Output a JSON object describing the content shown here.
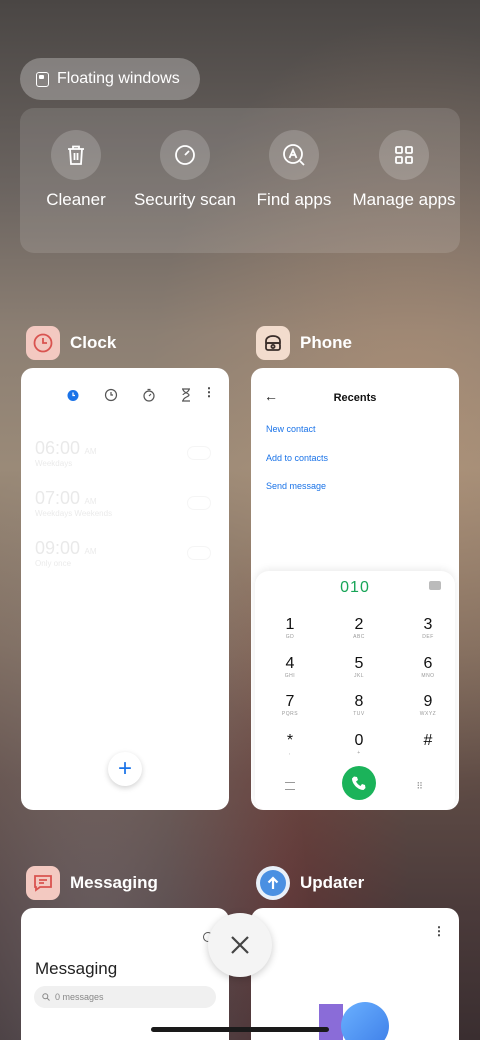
{
  "floating_windows": {
    "label": "Floating windows"
  },
  "tools": [
    {
      "label": "Cleaner",
      "icon": "trash-icon"
    },
    {
      "label": "Security scan",
      "icon": "security-scan-icon"
    },
    {
      "label": "Find apps",
      "icon": "find-apps-icon"
    },
    {
      "label": "Manage apps",
      "icon": "grid-icon"
    }
  ],
  "apps": {
    "clock": {
      "name": "Clock",
      "icon": "clock-icon",
      "color": "#f3c9c1"
    },
    "phone": {
      "name": "Phone",
      "icon": "phone-app-icon",
      "color": "#f2dccd"
    },
    "messaging": {
      "name": "Messaging",
      "icon": "messaging-icon",
      "color": "#f3c9c1"
    },
    "updater": {
      "name": "Updater",
      "icon": "updater-icon",
      "color": "#4a90e2"
    }
  },
  "clock_card": {
    "alarms": [
      {
        "time": "06:00",
        "suffix": "AM",
        "sub": "Weekdays"
      },
      {
        "time": "07:00",
        "suffix": "AM",
        "sub": "Weekdays  Weekends"
      },
      {
        "time": "09:00",
        "suffix": "AM",
        "sub": "Only once"
      }
    ],
    "fab": "+"
  },
  "phone_card": {
    "title": "Recents",
    "links": [
      "New contact",
      "Add to contacts",
      "Send message"
    ],
    "dialed": "010",
    "keys": [
      {
        "d": "1",
        "l": "GD"
      },
      {
        "d": "2",
        "l": "ABC"
      },
      {
        "d": "3",
        "l": "DEF"
      },
      {
        "d": "4",
        "l": "GHI"
      },
      {
        "d": "5",
        "l": "JKL"
      },
      {
        "d": "6",
        "l": "MNO"
      },
      {
        "d": "7",
        "l": "PQRS"
      },
      {
        "d": "8",
        "l": "TUV"
      },
      {
        "d": "9",
        "l": "WXYZ"
      },
      {
        "d": "*",
        "l": ","
      },
      {
        "d": "0",
        "l": "+"
      },
      {
        "d": "#",
        "l": ""
      }
    ]
  },
  "messaging_card": {
    "title": "Messaging",
    "search_placeholder": "0 messages"
  },
  "colors": {
    "call_green": "#1bb35a",
    "link_blue": "#1a73e8",
    "dial_green": "#18a558"
  }
}
